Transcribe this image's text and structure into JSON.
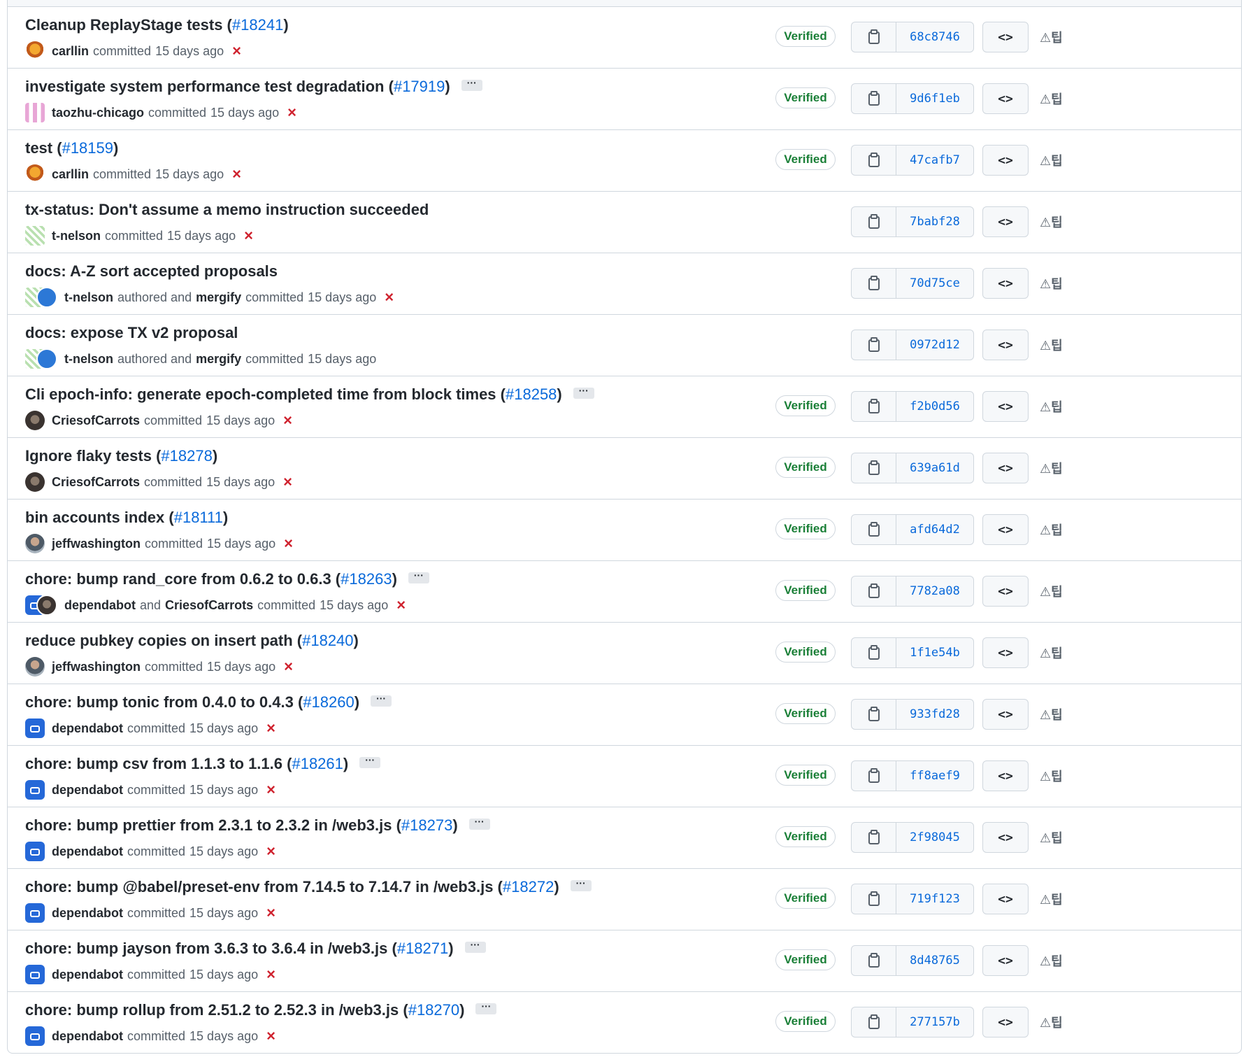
{
  "commits": [
    {
      "title": "Cleanup ReplayStage tests",
      "pr": "#18241",
      "avatars": [
        "carllin"
      ],
      "author": "carllin",
      "connector": "",
      "co": "",
      "verb": "committed",
      "time": "15 days ago",
      "status": "×",
      "ellipsis": false,
      "verified": "Verified",
      "sha": "68c8746"
    },
    {
      "title": "investigate system performance test degradation",
      "pr": "#17919",
      "avatars": [
        "taozhu"
      ],
      "author": "taozhu-chicago",
      "connector": "",
      "co": "",
      "verb": "committed",
      "time": "15 days ago",
      "status": "×",
      "ellipsis": true,
      "verified": "Verified",
      "sha": "9d6f1eb"
    },
    {
      "title": "test",
      "pr": "#18159",
      "avatars": [
        "carllin"
      ],
      "author": "carllin",
      "connector": "",
      "co": "",
      "verb": "committed",
      "time": "15 days ago",
      "status": "×",
      "ellipsis": false,
      "verified": "Verified",
      "sha": "47cafb7"
    },
    {
      "title": "tx-status: Don't assume a memo instruction succeeded",
      "pr": "",
      "avatars": [
        "tnelson"
      ],
      "author": "t-nelson",
      "connector": "",
      "co": "",
      "verb": "committed",
      "time": "15 days ago",
      "status": "×",
      "ellipsis": false,
      "verified": "",
      "sha": "7babf28"
    },
    {
      "title": "docs: A-Z sort accepted proposals",
      "pr": "",
      "avatars": [
        "tnelson",
        "mergify"
      ],
      "author": "t-nelson",
      "connector": "authored and",
      "co": "mergify",
      "verb": "committed",
      "time": "15 days ago",
      "status": "×",
      "ellipsis": false,
      "verified": "",
      "sha": "70d75ce"
    },
    {
      "title": "docs: expose TX v2 proposal",
      "pr": "",
      "avatars": [
        "tnelson",
        "mergify"
      ],
      "author": "t-nelson",
      "connector": "authored and",
      "co": "mergify",
      "verb": "committed",
      "time": "15 days ago",
      "status": "",
      "ellipsis": false,
      "verified": "",
      "sha": "0972d12"
    },
    {
      "title": "Cli epoch-info: generate epoch-completed time from block times",
      "pr": "#18258",
      "avatars": [
        "cries"
      ],
      "author": "CriesofCarrots",
      "connector": "",
      "co": "",
      "verb": "committed",
      "time": "15 days ago",
      "status": "×",
      "ellipsis": true,
      "verified": "Verified",
      "sha": "f2b0d56"
    },
    {
      "title": "Ignore flaky tests",
      "pr": "#18278",
      "avatars": [
        "cries"
      ],
      "author": "CriesofCarrots",
      "connector": "",
      "co": "",
      "verb": "committed",
      "time": "15 days ago",
      "status": "×",
      "ellipsis": false,
      "verified": "Verified",
      "sha": "639a61d"
    },
    {
      "title": "bin accounts index",
      "pr": "#18111",
      "avatars": [
        "jeff"
      ],
      "author": "jeffwashington",
      "connector": "",
      "co": "",
      "verb": "committed",
      "time": "15 days ago",
      "status": "×",
      "ellipsis": false,
      "verified": "Verified",
      "sha": "afd64d2"
    },
    {
      "title": "chore: bump rand_core from 0.6.2 to 0.6.3",
      "pr": "#18263",
      "avatars": [
        "depbot",
        "cries"
      ],
      "author": "dependabot",
      "connector": "and",
      "co": "CriesofCarrots",
      "verb": "committed",
      "time": "15 days ago",
      "status": "×",
      "ellipsis": true,
      "verified": "Verified",
      "sha": "7782a08"
    },
    {
      "title": "reduce pubkey copies on insert path",
      "pr": "#18240",
      "avatars": [
        "jeff"
      ],
      "author": "jeffwashington",
      "connector": "",
      "co": "",
      "verb": "committed",
      "time": "15 days ago",
      "status": "×",
      "ellipsis": false,
      "verified": "Verified",
      "sha": "1f1e54b"
    },
    {
      "title": "chore: bump tonic from 0.4.0 to 0.4.3",
      "pr": "#18260",
      "avatars": [
        "depbot"
      ],
      "author": "dependabot",
      "connector": "",
      "co": "",
      "verb": "committed",
      "time": "15 days ago",
      "status": "×",
      "ellipsis": true,
      "verified": "Verified",
      "sha": "933fd28"
    },
    {
      "title": "chore: bump csv from 1.1.3 to 1.1.6",
      "pr": "#18261",
      "avatars": [
        "depbot"
      ],
      "author": "dependabot",
      "connector": "",
      "co": "",
      "verb": "committed",
      "time": "15 days ago",
      "status": "×",
      "ellipsis": true,
      "verified": "Verified",
      "sha": "ff8aef9"
    },
    {
      "title": "chore: bump prettier from 2.3.1 to 2.3.2 in /web3.js",
      "pr": "#18273",
      "avatars": [
        "depbot"
      ],
      "author": "dependabot",
      "connector": "",
      "co": "",
      "verb": "committed",
      "time": "15 days ago",
      "status": "×",
      "ellipsis": true,
      "verified": "Verified",
      "sha": "2f98045"
    },
    {
      "title": "chore: bump @babel/preset-env from 7.14.5 to 7.14.7 in /web3.js",
      "pr": "#18272",
      "avatars": [
        "depbot"
      ],
      "author": "dependabot",
      "connector": "",
      "co": "",
      "verb": "committed",
      "time": "15 days ago",
      "status": "×",
      "ellipsis": true,
      "verified": "Verified",
      "sha": "719f123"
    },
    {
      "title": "chore: bump jayson from 3.6.3 to 3.6.4 in /web3.js",
      "pr": "#18271",
      "avatars": [
        "depbot"
      ],
      "author": "dependabot",
      "connector": "",
      "co": "",
      "verb": "committed",
      "time": "15 days ago",
      "status": "×",
      "ellipsis": true,
      "verified": "Verified",
      "sha": "8d48765"
    },
    {
      "title": "chore: bump rollup from 2.51.2 to 2.52.3 in /web3.js",
      "pr": "#18270",
      "avatars": [
        "depbot"
      ],
      "author": "dependabot",
      "connector": "",
      "co": "",
      "verb": "committed",
      "time": "15 days ago",
      "status": "×",
      "ellipsis": true,
      "verified": "Verified",
      "sha": "277157b"
    }
  ],
  "icons": {
    "copy": "clipboard-icon",
    "browse": "code-icon",
    "extension": "extension-icon"
  },
  "browse_glyph": "<>",
  "extension_glyph": "⚠팁",
  "colors": {
    "link": "#0969da",
    "verified": "#1a7f37",
    "fail": "#cf222e",
    "border": "#d0d7de"
  }
}
